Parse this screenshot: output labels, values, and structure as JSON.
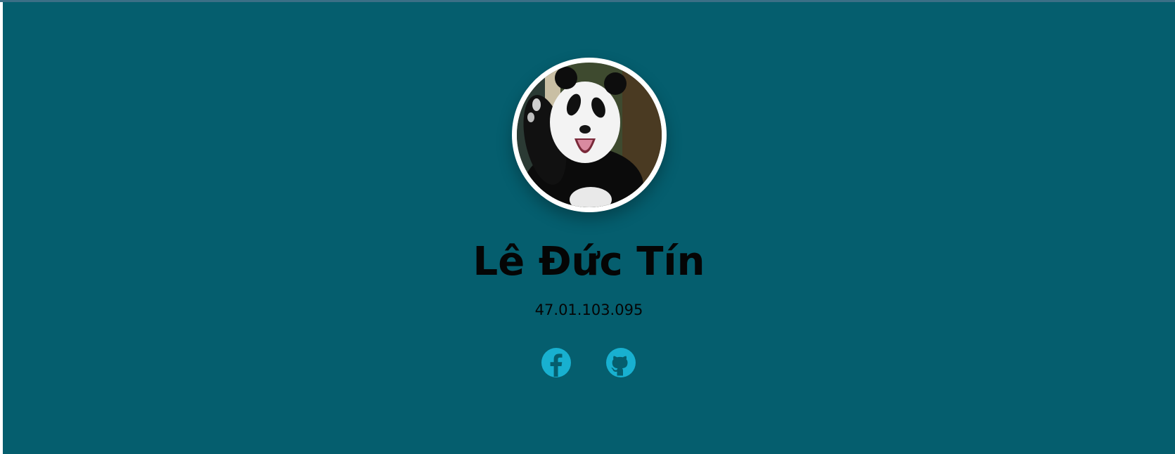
{
  "profile": {
    "name": "Lê Đức Tín",
    "student_id": "47.01.103.095",
    "avatar_alt": "panda"
  },
  "social": [
    {
      "icon": "facebook-icon",
      "label": "Facebook"
    },
    {
      "icon": "github-icon",
      "label": "GitHub"
    }
  ],
  "colors": {
    "background": "#055e6e",
    "icon": "#18b0d0",
    "text": "#050505",
    "avatar_border": "#ffffff"
  }
}
